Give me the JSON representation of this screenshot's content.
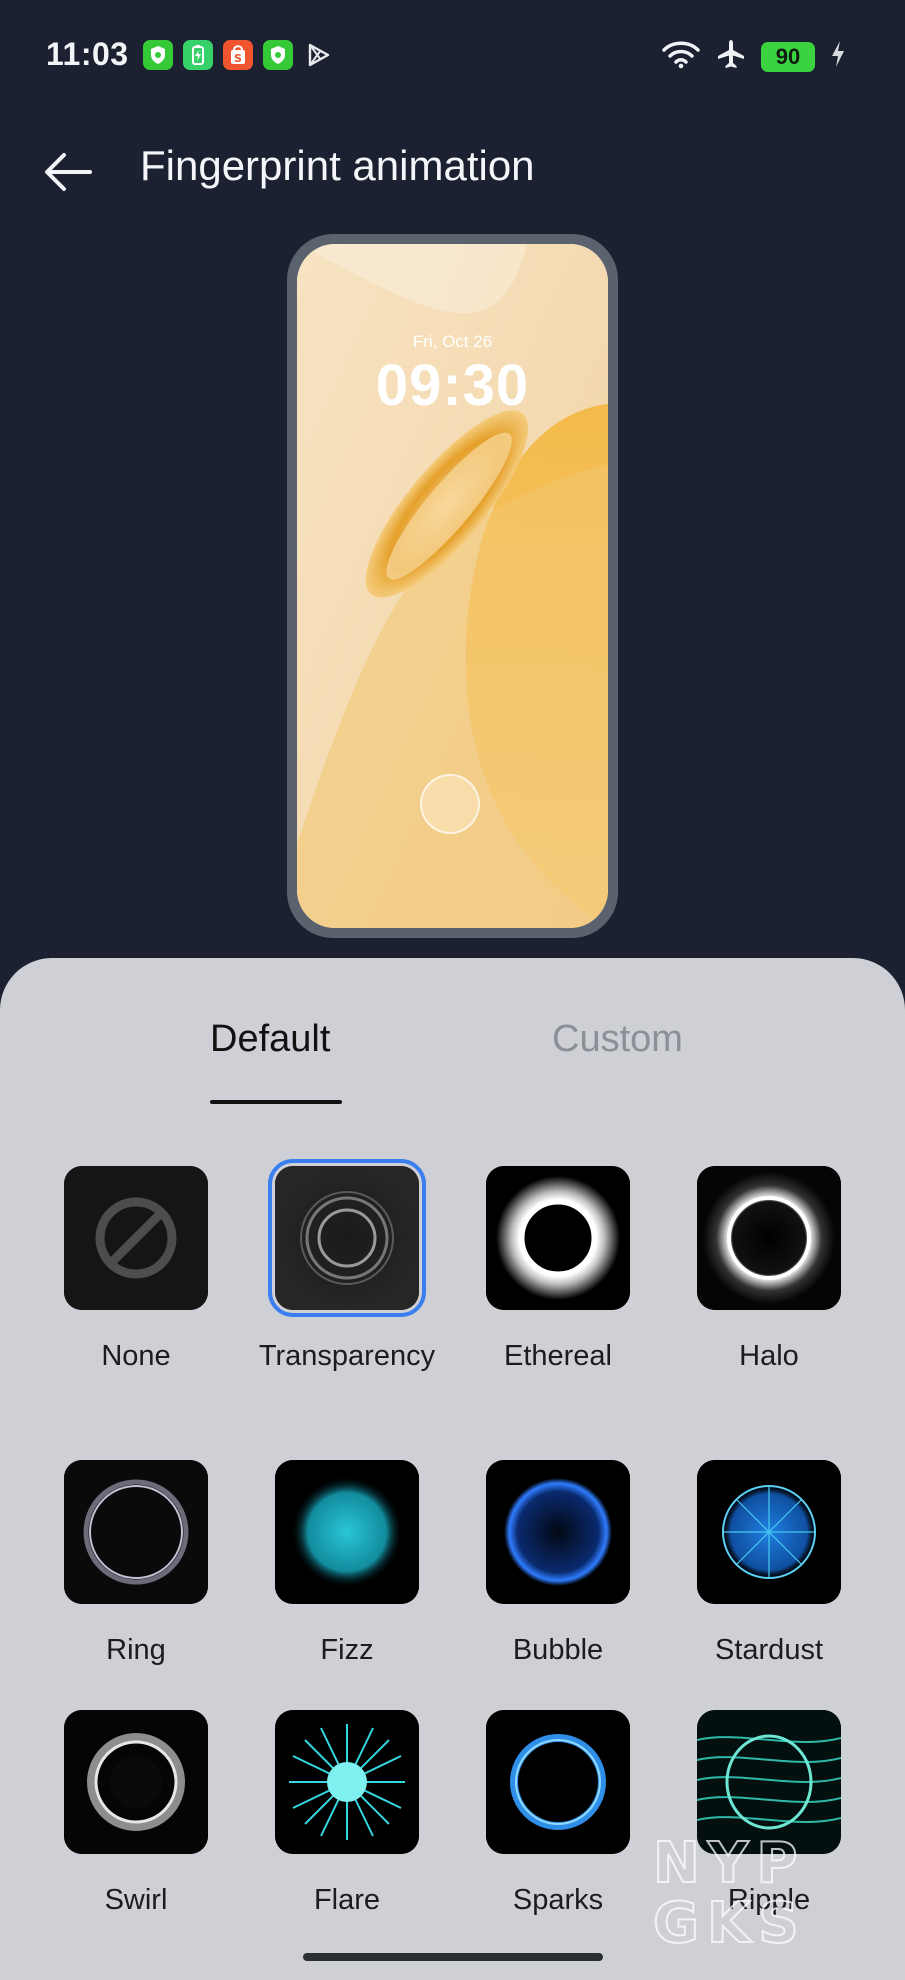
{
  "status_bar": {
    "time": "11:03",
    "battery_level": "90",
    "app_icons": [
      {
        "name": "shield-green-icon",
        "color": "#36c936"
      },
      {
        "name": "battery-app-icon",
        "color": "#37d16a"
      },
      {
        "name": "shopee-icon",
        "color": "#f0552f"
      },
      {
        "name": "shield-green-icon",
        "color": "#36c936"
      },
      {
        "name": "play-store-icon",
        "color": "#ffffff"
      }
    ]
  },
  "header": {
    "title": "Fingerprint animation"
  },
  "preview": {
    "date": "Fri, Oct 26",
    "time": "09:30"
  },
  "tabs": [
    {
      "label": "Default",
      "active": true
    },
    {
      "label": "Custom",
      "active": false
    }
  ],
  "animations": [
    {
      "label": "None",
      "icon": "none-icon",
      "selected": false
    },
    {
      "label": "Transparency",
      "icon": "transparency-ring-icon",
      "selected": true
    },
    {
      "label": "Ethereal",
      "icon": "ethereal-ring-icon",
      "selected": false
    },
    {
      "label": "Halo",
      "icon": "halo-ring-icon",
      "selected": false
    },
    {
      "label": "Ring",
      "icon": "ring-icon",
      "selected": false
    },
    {
      "label": "Fizz",
      "icon": "fizz-icon",
      "selected": false
    },
    {
      "label": "Bubble",
      "icon": "bubble-icon",
      "selected": false
    },
    {
      "label": "Stardust",
      "icon": "stardust-icon",
      "selected": false
    },
    {
      "label": "Swirl",
      "icon": "swirl-icon",
      "selected": false
    },
    {
      "label": "Flare",
      "icon": "flare-icon",
      "selected": false
    },
    {
      "label": "Sparks",
      "icon": "sparks-icon",
      "selected": false
    },
    {
      "label": "Ripple",
      "icon": "ripple-icon",
      "selected": false
    }
  ],
  "watermark": {
    "text_line1": "NYP",
    "text_line2": "GKS"
  },
  "colors": {
    "background": "#1b2130",
    "sheet": "#ced0d5",
    "selection": "#3a7ef0",
    "battery": "#3bd23f"
  }
}
